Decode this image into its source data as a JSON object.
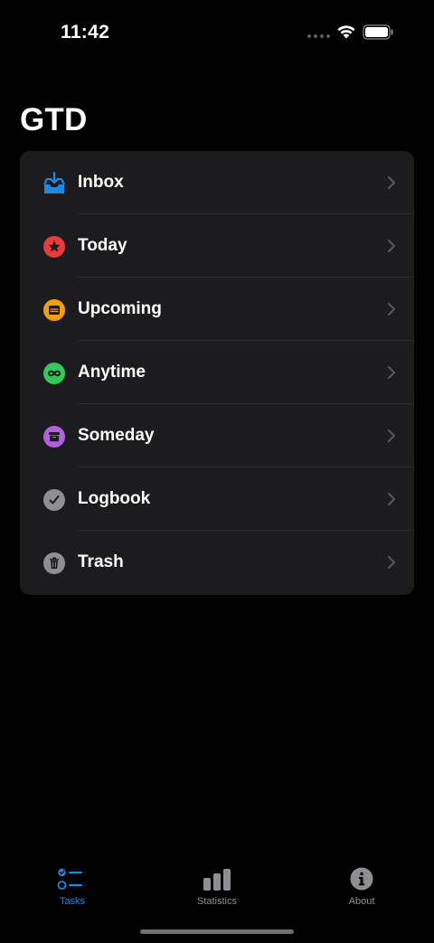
{
  "status_bar": {
    "time": "11:42"
  },
  "title": "GTD",
  "list": {
    "items": [
      {
        "label": "Inbox",
        "icon": "inbox-tray-icon",
        "color": "#1e88e5"
      },
      {
        "label": "Today",
        "icon": "star-icon",
        "color": "#ea3b3b"
      },
      {
        "label": "Upcoming",
        "icon": "calendar-icon",
        "color": "#f59e0b"
      },
      {
        "label": "Anytime",
        "icon": "infinity-icon",
        "color": "#34c759"
      },
      {
        "label": "Someday",
        "icon": "archive-box-icon",
        "color": "#b45fe0"
      },
      {
        "label": "Logbook",
        "icon": "checkmark-icon",
        "color": "#8e8e93"
      },
      {
        "label": "Trash",
        "icon": "trash-icon",
        "color": "#8e8e93"
      }
    ]
  },
  "tab_bar": {
    "tabs": [
      {
        "label": "Tasks",
        "icon": "checklist-icon",
        "selected": true
      },
      {
        "label": "Statistics",
        "icon": "bar-chart-icon",
        "selected": false
      },
      {
        "label": "About",
        "icon": "info-icon",
        "selected": false
      }
    ],
    "active_color": "#1e88e5",
    "inactive_color": "#8e8e93"
  }
}
